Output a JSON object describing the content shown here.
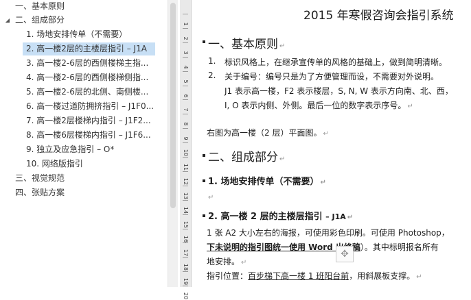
{
  "nav": {
    "items": [
      {
        "label": "一、基本原则",
        "arrow": ""
      },
      {
        "label": "二、组成部分",
        "arrow": "◢"
      },
      {
        "label": "1. 场地安排传单（不需要）"
      },
      {
        "label": "2. 高一楼2层的主楼层指引 – J1A"
      },
      {
        "label": "3. 高一楼2-6层的西侧楼梯主指..."
      },
      {
        "label": "4. 高一楼2-6层的西侧楼梯侧指..."
      },
      {
        "label": "5. 高一楼2-6层的北侧、南侧楼..."
      },
      {
        "label": "6. 高一楼过道防拥挤指引 – J1F0..."
      },
      {
        "label": "7. 高一楼2层楼梯内指引 – J1F2..."
      },
      {
        "label": "8. 高一楼6层楼梯内指引 – J1F6..."
      },
      {
        "label": "9. 独立及应急指引 – O*"
      },
      {
        "label": "10. 网络版指引"
      },
      {
        "label": "三、视觉规范"
      },
      {
        "label": "四、张贴方案"
      }
    ]
  },
  "ruler": {
    "numbers": [
      "1",
      "2",
      "3",
      "4",
      "5",
      "6",
      "7",
      "8",
      "9",
      "10",
      "11",
      "12",
      "13",
      "14",
      "15",
      "16",
      "17",
      "18",
      "19",
      "20"
    ]
  },
  "doc": {
    "title": "2015 年寒假咨询会指引系统",
    "section1": "一、基本原则",
    "item1_num": "1.",
    "item1_text": "标识风格上，在继承宣传单的风格的基础上，做到简明清晰。",
    "item2_num": "2.",
    "item2_text": "关于编号：编号只是为了方便管理而设，不需要对外说明。",
    "item2_line2": "J1 表示高一楼，F2 表示楼层，S, N, W 表示方向南、北、西，",
    "item2_line3": "I, O 表示内侧、外侧。最后一位的数字表示序号。",
    "plan_note": "右图为高一楼（2 层）平面图。",
    "section2": "二、组成部分",
    "sub1": "1.  场地安排传单（不需要）",
    "sub2_prefix": "2.  高一楼 2 层的主楼层指引 ",
    "sub2_code": "– J1A",
    "body1": "1 张 A2 大小左右的海报，可使用彩色印刷。可使用 Photoshop，",
    "body2_u": "下未说明的指引图统一使用 Word 出终稿",
    "body2_rest": "）。其中标明报名所有",
    "body3": "地安排。",
    "body4_prefix": "指引位置：",
    "body4_u": "百步梯下高一楼 1 班阳台前",
    "body4_rest": "，用斜展板支撑。",
    "para_mark": "↵",
    "handle_glyph": "✥"
  },
  "colors": {
    "selected_bg": "#c7dff5",
    "ruler_bg": "#e9e9e9",
    "page_bg": "#ffffff"
  }
}
